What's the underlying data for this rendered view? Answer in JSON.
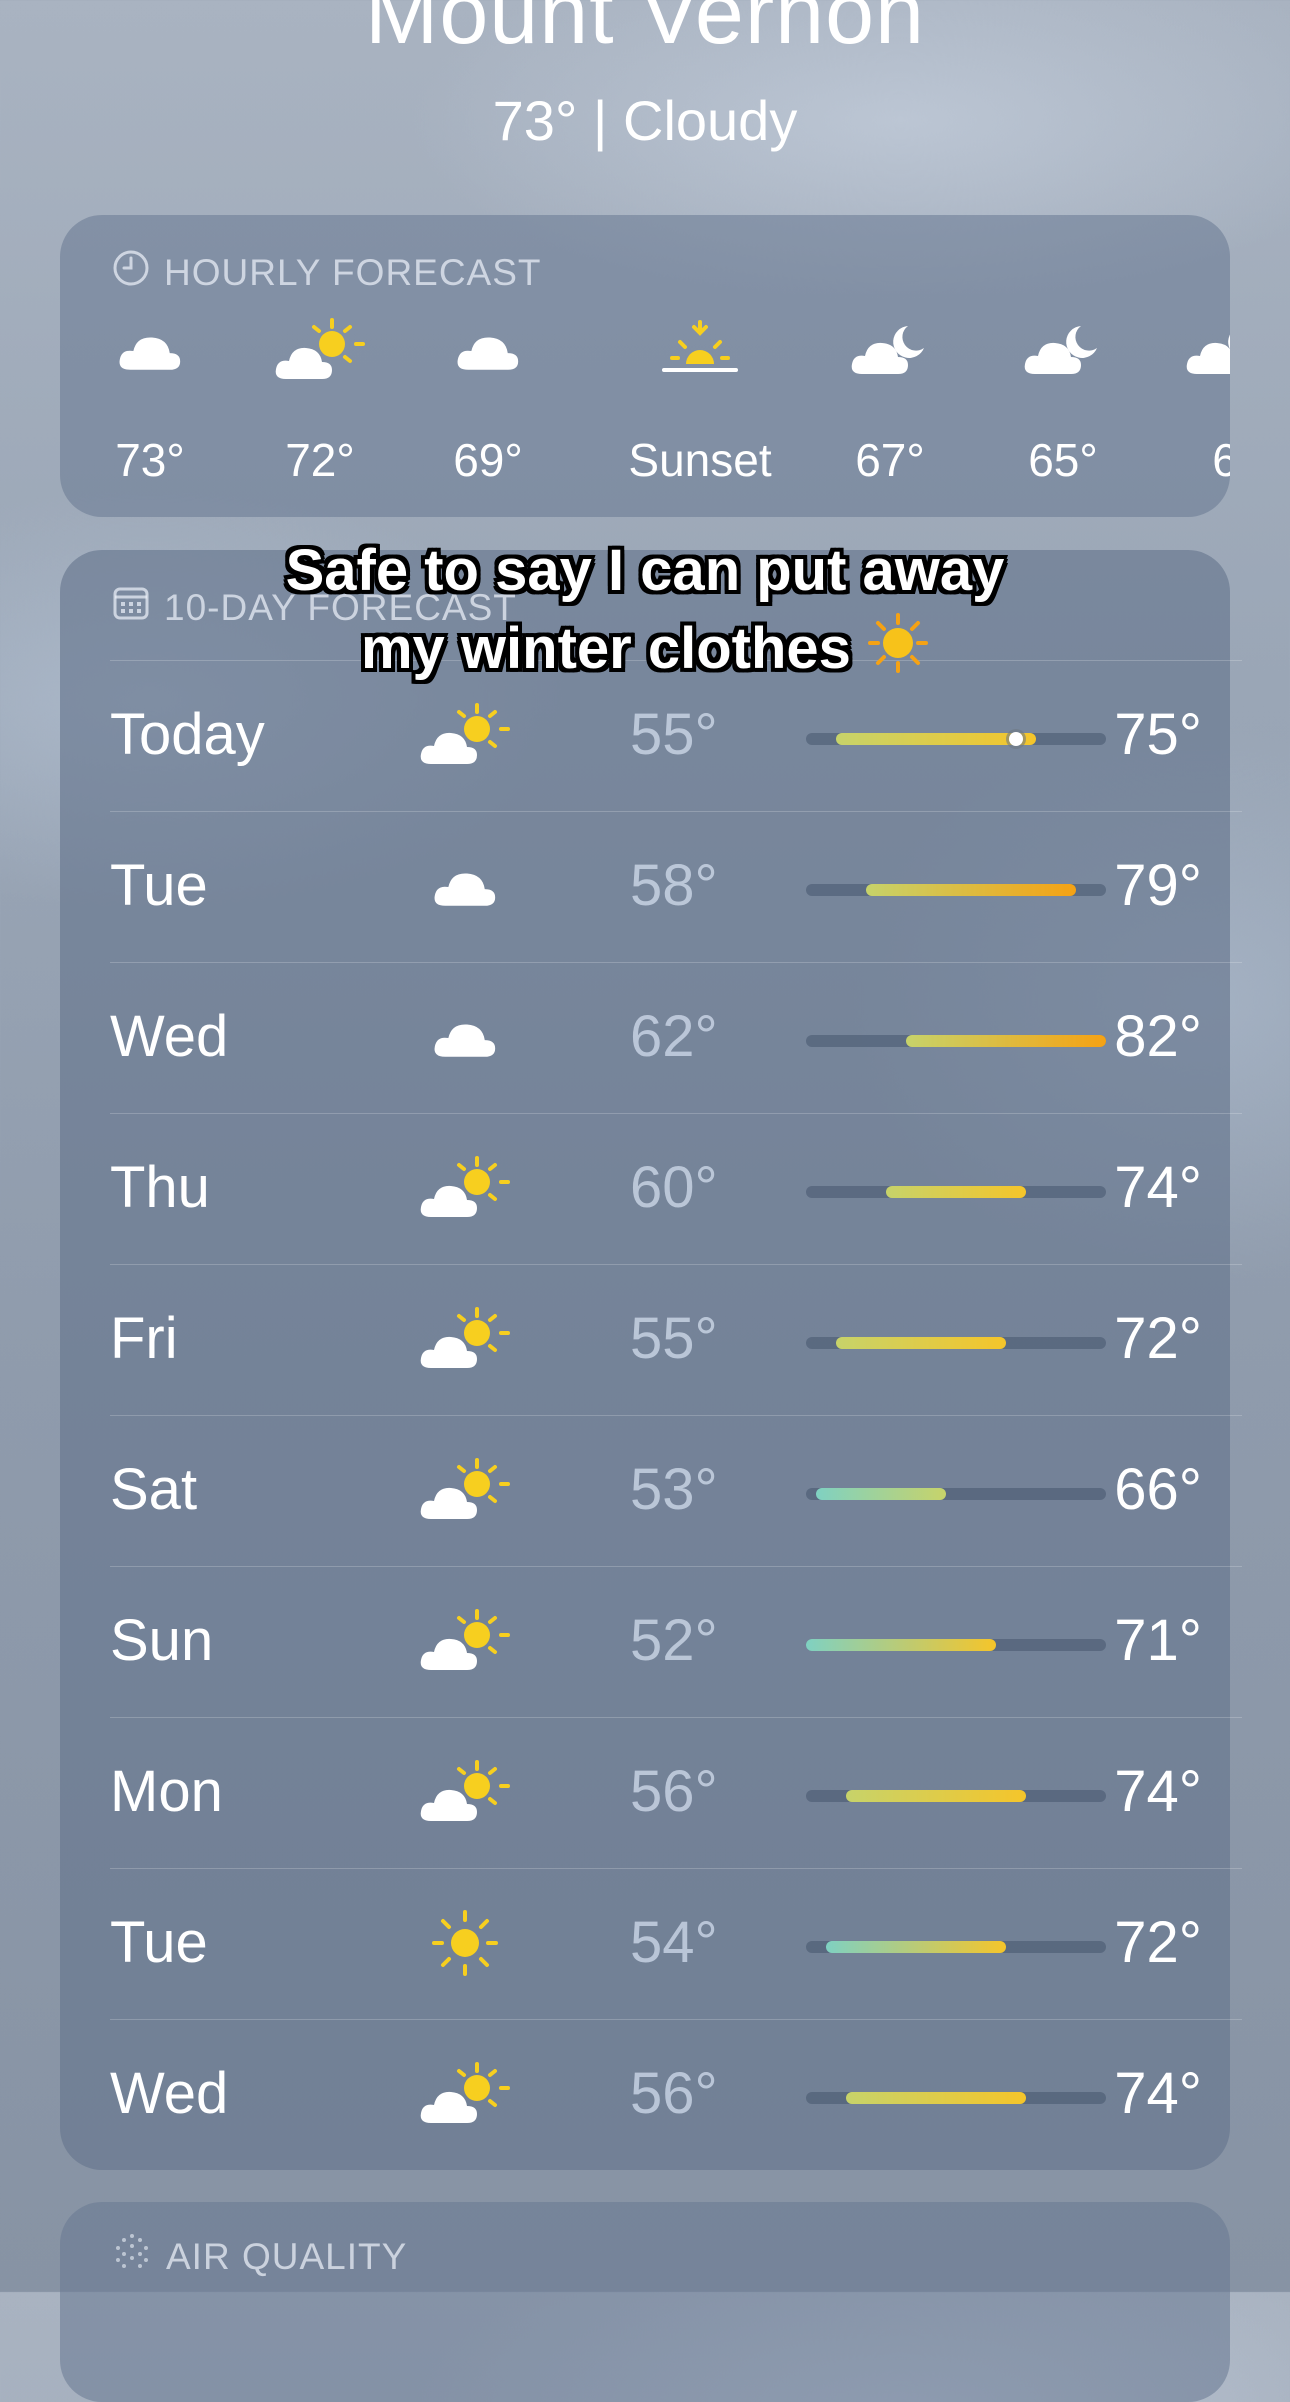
{
  "header": {
    "city": "Mount Vernon",
    "summary": "73° | Cloudy"
  },
  "hourly": {
    "title": "HOURLY FORECAST",
    "items": [
      {
        "icon": "cloud-icon",
        "label": "73°"
      },
      {
        "icon": "partly-sunny-icon",
        "label": "72°"
      },
      {
        "icon": "cloud-icon",
        "label": "69°"
      },
      {
        "icon": "sunset-icon",
        "label": "Sunset"
      },
      {
        "icon": "partly-cloudy-night-icon",
        "label": "67°"
      },
      {
        "icon": "partly-cloudy-night-icon",
        "label": "65°"
      },
      {
        "icon": "partly-cloudy-night-icon",
        "label": "6"
      }
    ]
  },
  "daily": {
    "title": "10-DAY FORECAST",
    "days": [
      {
        "day": "Today",
        "icon": "partly-sunny-icon",
        "low": "55°",
        "high": "75°",
        "range": [
          55,
          75
        ],
        "current": 73
      },
      {
        "day": "Tue",
        "icon": "cloud-icon",
        "low": "58°",
        "high": "79°",
        "range": [
          58,
          79
        ]
      },
      {
        "day": "Wed",
        "icon": "cloud-icon",
        "low": "62°",
        "high": "82°",
        "range": [
          62,
          82
        ]
      },
      {
        "day": "Thu",
        "icon": "partly-sunny-icon",
        "low": "60°",
        "high": "74°",
        "range": [
          60,
          74
        ]
      },
      {
        "day": "Fri",
        "icon": "partly-sunny-icon",
        "low": "55°",
        "high": "72°",
        "range": [
          55,
          72
        ]
      },
      {
        "day": "Sat",
        "icon": "partly-sunny-icon",
        "low": "53°",
        "high": "66°",
        "range": [
          53,
          66
        ]
      },
      {
        "day": "Sun",
        "icon": "partly-sunny-icon",
        "low": "52°",
        "high": "71°",
        "range": [
          52,
          71
        ]
      },
      {
        "day": "Mon",
        "icon": "partly-sunny-icon",
        "low": "56°",
        "high": "74°",
        "range": [
          56,
          74
        ]
      },
      {
        "day": "Tue",
        "icon": "sun-icon",
        "low": "54°",
        "high": "72°",
        "range": [
          54,
          72
        ]
      },
      {
        "day": "Wed",
        "icon": "partly-sunny-icon",
        "low": "56°",
        "high": "74°",
        "range": [
          56,
          74
        ]
      }
    ],
    "scale": [
      52,
      82
    ]
  },
  "air_quality": {
    "title": "AIR QUALITY"
  },
  "caption": {
    "line1": "Safe to say I can put away",
    "line2": "my winter clothes",
    "emoji": "sun-emoji"
  },
  "colors": {
    "sun": "#f7cf1f",
    "cool": "#7fd1c2",
    "mild": "#c7d36a",
    "warm": "#f5c52a",
    "hot": "#f5a214"
  }
}
